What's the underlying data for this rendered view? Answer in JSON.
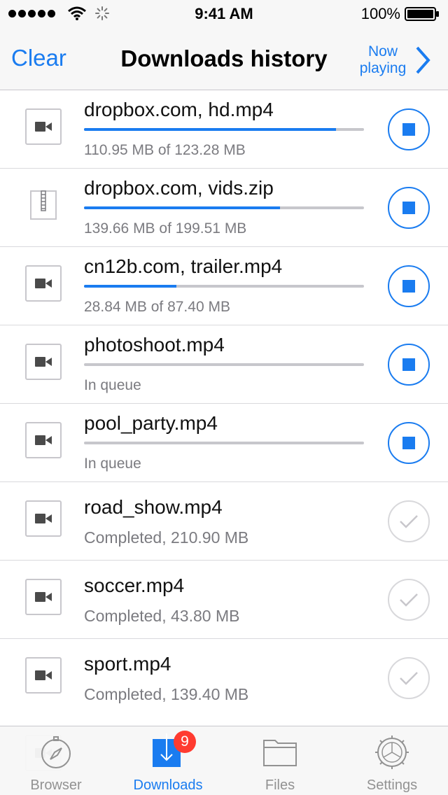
{
  "status_bar": {
    "time": "9:41 AM",
    "battery_percent": "100%",
    "icons": [
      "signal-dots-icon",
      "wifi-icon",
      "activity-spinner-icon",
      "battery-icon"
    ]
  },
  "nav": {
    "clear_label": "Clear",
    "title": "Downloads history",
    "now_playing_line1": "Now",
    "now_playing_line2": "playing"
  },
  "downloads": [
    {
      "name": "dropbox.com, hd.mp4",
      "detail": "110.95 MB of 123.28 MB",
      "status": "downloading",
      "progress": 0.9,
      "type": "video"
    },
    {
      "name": "dropbox.com, vids.zip",
      "detail": "139.66 MB of 199.51 MB",
      "status": "downloading",
      "progress": 0.7,
      "type": "archive"
    },
    {
      "name": "cn12b.com, trailer.mp4",
      "detail": "28.84 MB of 87.40 MB",
      "status": "downloading",
      "progress": 0.33,
      "type": "video"
    },
    {
      "name": "photoshoot.mp4",
      "detail": "In queue",
      "status": "queued",
      "progress": 0,
      "type": "video"
    },
    {
      "name": "pool_party.mp4",
      "detail": "In queue",
      "status": "queued",
      "progress": 0,
      "type": "video"
    },
    {
      "name": "road_show.mp4",
      "detail": "Completed, 210.90 MB",
      "status": "completed",
      "type": "video"
    },
    {
      "name": "soccer.mp4",
      "detail": "Completed, 43.80 MB",
      "status": "completed",
      "type": "video"
    },
    {
      "name": "sport.mp4",
      "detail": "Completed, 139.40 MB",
      "status": "completed",
      "type": "video"
    }
  ],
  "tabs": [
    {
      "label": "Browser",
      "icon": "compass-icon"
    },
    {
      "label": "Downloads",
      "icon": "download-icon",
      "badge": "9",
      "active": true
    },
    {
      "label": "Files",
      "icon": "folder-icon"
    },
    {
      "label": "Settings",
      "icon": "gear-icon"
    }
  ],
  "colors": {
    "accent": "#1a7cf0",
    "badge": "#ff3b30",
    "inactive": "#929292"
  }
}
